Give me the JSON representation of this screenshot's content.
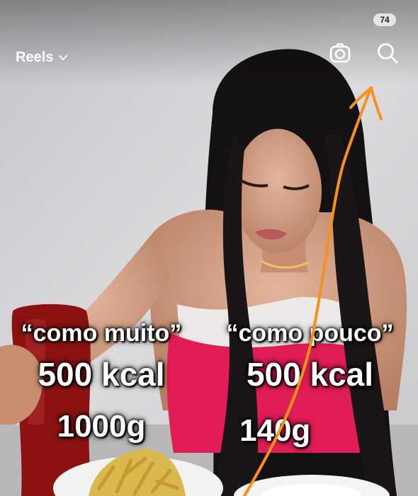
{
  "header": {
    "feed_label": "Reels",
    "notification_count": "74"
  },
  "overlay": {
    "left": {
      "quote": "“como muito”",
      "kcal": "500 kcal",
      "grams": "1000g"
    },
    "right": {
      "quote": "“como pouco”",
      "kcal": "500 kcal",
      "grams": "140g"
    }
  },
  "icons": {
    "menu": "chevron-down-icon",
    "camera": "camera-icon",
    "search": "search-icon"
  },
  "colors": {
    "annotation_arrow": "#f7901e",
    "top_dress": "#e11d55",
    "ketchup": "#8c1212",
    "fries": "#d9b94f"
  }
}
